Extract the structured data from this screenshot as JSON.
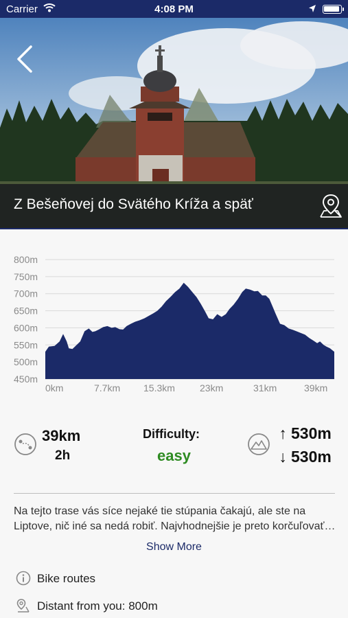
{
  "status_bar": {
    "carrier": "Carrier",
    "time": "4:08 PM"
  },
  "header": {
    "title": "Z Bešeňovej do Svätého Kríža a späť",
    "back_icon": "chevron-left-icon",
    "map_icon": "map-pin-icon"
  },
  "colors": {
    "brand": "#1b2a68",
    "chart_fill": "#1b2a68",
    "difficulty_easy": "#2e8b22"
  },
  "chart_data": {
    "type": "area",
    "title": "",
    "xlabel": "",
    "ylabel": "",
    "x_ticks": [
      "0km",
      "7.7km",
      "15.3km",
      "23km",
      "31km",
      "39km"
    ],
    "y_ticks": [
      "800m",
      "750m",
      "700m",
      "650m",
      "600m",
      "550m",
      "500m",
      "450m"
    ],
    "xlim": [
      0,
      40.5
    ],
    "ylim": [
      450,
      800
    ],
    "grid": true,
    "series": [
      {
        "x": [
          0,
          0.5,
          1.3,
          2.0,
          2.5,
          3.0,
          3.3,
          3.8,
          4.3,
          4.9,
          5.5,
          6.1,
          6.6,
          7.0,
          7.5,
          8.1,
          8.7,
          9.3,
          9.8,
          10.4,
          10.9,
          11.4,
          12.0,
          12.6,
          13.2,
          13.9,
          14.5,
          15.1,
          15.7,
          16.3,
          16.9,
          17.6,
          18.2,
          18.8,
          19.4,
          20.0,
          20.6,
          21.2,
          21.8,
          22.4,
          22.9,
          23.5,
          24.1,
          24.7,
          25.3,
          25.8,
          26.4,
          27.0,
          27.6,
          28.1,
          28.7,
          29.3,
          29.8,
          30.4,
          30.9,
          31.4,
          31.8,
          32.3,
          32.9,
          33.5,
          34.1,
          34.7,
          35.2,
          35.8,
          36.4,
          37.0,
          37.6,
          38.1,
          38.5,
          39.0,
          39.4,
          39.9,
          40.5
        ],
        "y": [
          530,
          545,
          547,
          560,
          582,
          560,
          540,
          538,
          548,
          560,
          590,
          598,
          588,
          590,
          595,
          602,
          605,
          600,
          602,
          596,
          595,
          605,
          612,
          618,
          622,
          628,
          635,
          642,
          650,
          662,
          678,
          692,
          705,
          715,
          732,
          720,
          705,
          690,
          670,
          648,
          628,
          625,
          640,
          632,
          640,
          655,
          668,
          685,
          705,
          715,
          712,
          707,
          708,
          695,
          695,
          685,
          665,
          640,
          612,
          608,
          598,
          594,
          590,
          585,
          580,
          570,
          562,
          555,
          560,
          550,
          545,
          540,
          530
        ]
      }
    ]
  },
  "stats": {
    "distance": "39km",
    "duration": "2h",
    "difficulty_label": "Difficulty:",
    "difficulty_value": "easy",
    "ascent": "530m",
    "descent": "530m",
    "route_icon": "route-icon",
    "mountain_icon": "mountain-icon"
  },
  "description": {
    "line1": "Na tejto trase vás síce nejaké tie stúpania čakajú, ale ste na",
    "line2": "Liptove, nič iné sa nedá robiť. Najvhodnejšie je preto korčuľovať začať…"
  },
  "show_more": "Show More",
  "info": {
    "category_icon": "info-icon",
    "category": "Bike routes",
    "distance_icon": "location-icon",
    "distance_from_you": "Distant from you: 800m"
  }
}
